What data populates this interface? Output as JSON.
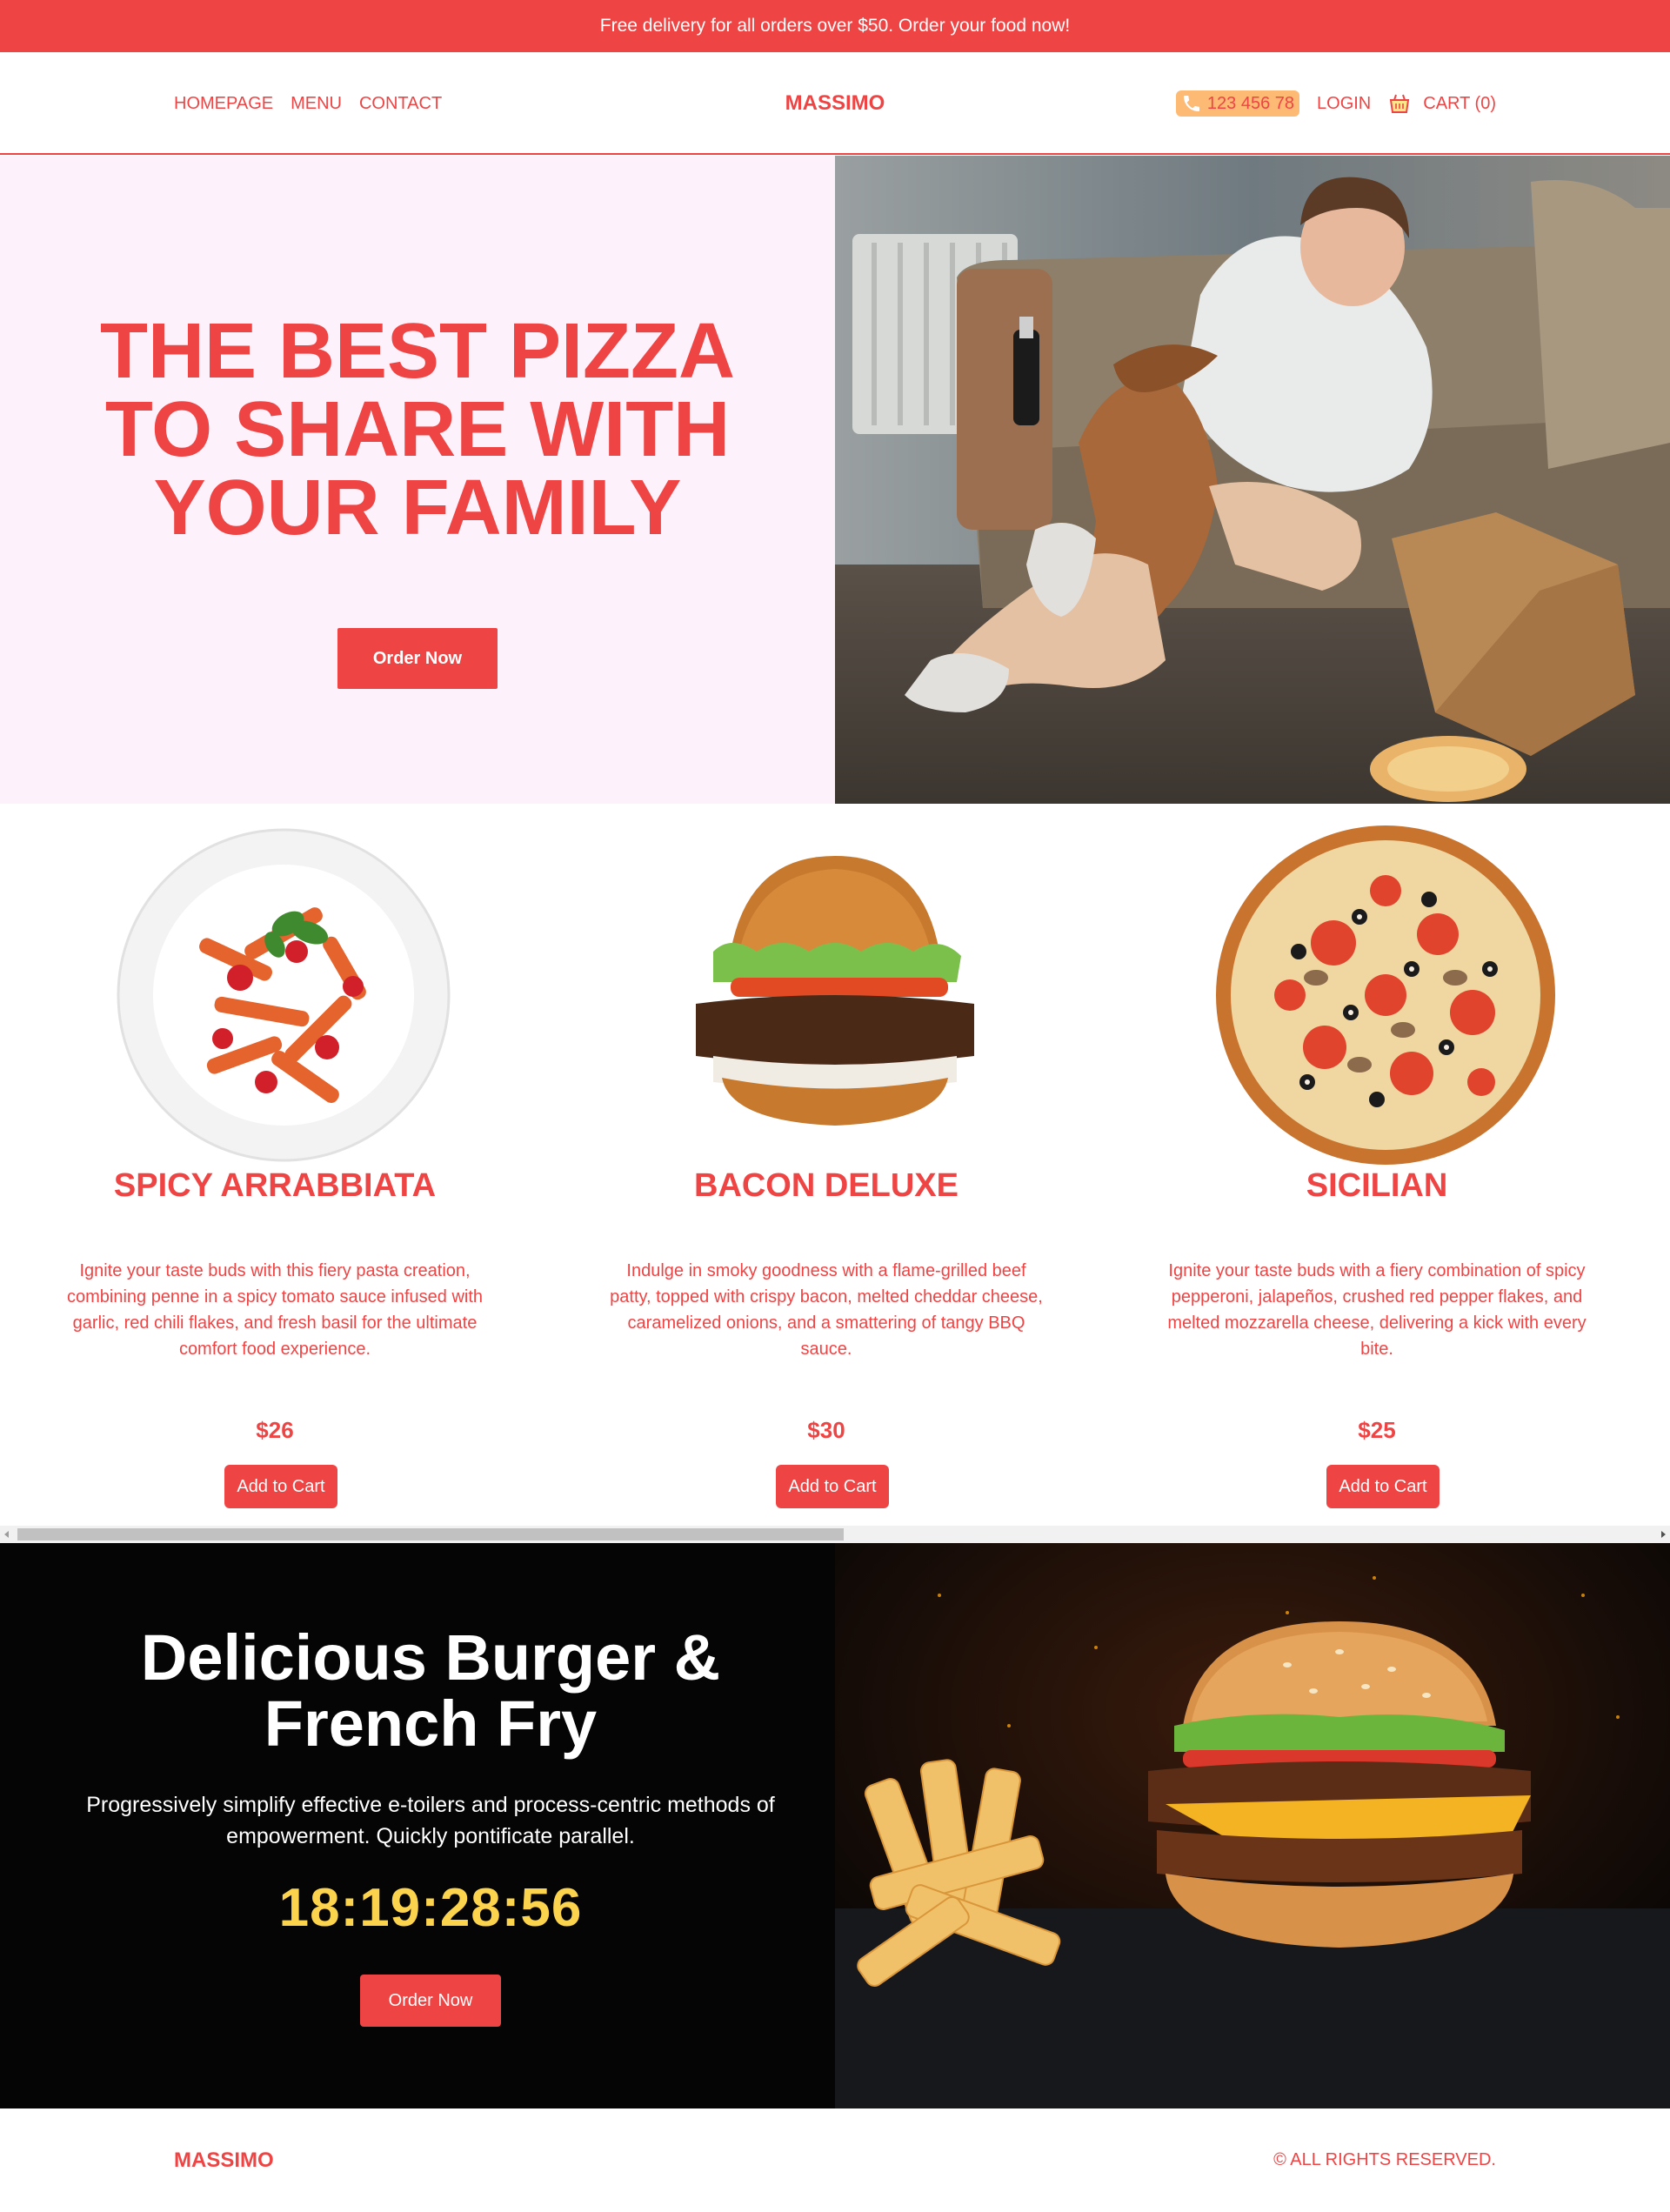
{
  "announcement": "Free delivery for all orders over $50. Order your food now!",
  "nav": {
    "links": [
      "HOMEPAGE",
      "MENU",
      "CONTACT"
    ],
    "brand": "MASSIMO",
    "phone": "123 456 78",
    "login": "LOGIN",
    "cart": "CART (0)"
  },
  "hero": {
    "title": "THE BEST PIZZA TO SHARE WITH YOUR FAMILY",
    "button": "Order Now"
  },
  "products": [
    {
      "name": "SPICY ARRABBIATA",
      "description": "Ignite your taste buds with this fiery pasta creation, combining penne in a spicy tomato sauce infused with garlic, red chili flakes, and fresh basil for the ultimate comfort food experience.",
      "price": "$26",
      "button": "Add to Cart"
    },
    {
      "name": "BACON DELUXE",
      "description": "Indulge in smoky goodness with a flame-grilled beef patty, topped with crispy bacon, melted cheddar cheese, caramelized onions, and a smattering of tangy BBQ sauce.",
      "price": "$30",
      "button": "Add to Cart"
    },
    {
      "name": "SICILIAN",
      "description": "Ignite your taste buds with a fiery combination of spicy pepperoni, jalapeños, crushed red pepper flakes, and melted mozzarella cheese, delivering a kick with every bite.",
      "price": "$25",
      "button": "Add to Cart"
    }
  ],
  "promo": {
    "title": "Delicious Burger & French Fry",
    "text": "Progressively simplify effective e-toilers and process-centric methods of empowerment. Quickly pontificate parallel.",
    "timer": "18:19:28:56",
    "button": "Order Now"
  },
  "footer": {
    "brand": "MASSIMO",
    "copyright": "© ALL RIGHTS RESERVED."
  },
  "colors": {
    "accent": "#ef4444",
    "hero_bg": "#fdf2fb",
    "phone_pill": "#fdba74",
    "timer": "#fcd34d",
    "promo_bg": "#050505"
  },
  "icons": [
    "phone-icon",
    "cart-icon"
  ]
}
